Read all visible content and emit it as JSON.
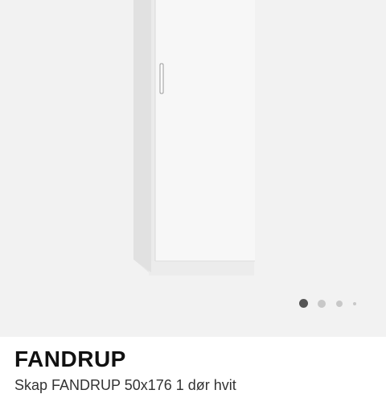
{
  "product": {
    "name": "FANDRUP",
    "description": "Skap FANDRUP 50x176 1 dør hvit"
  },
  "gallery": {
    "image": "cabinet-image",
    "slide_count": 4,
    "active_slide": 1
  },
  "colors": {
    "gallery_background": "#f2f2f2",
    "dot_active": "#555555",
    "dot_inactive": "#c8c8c8"
  }
}
